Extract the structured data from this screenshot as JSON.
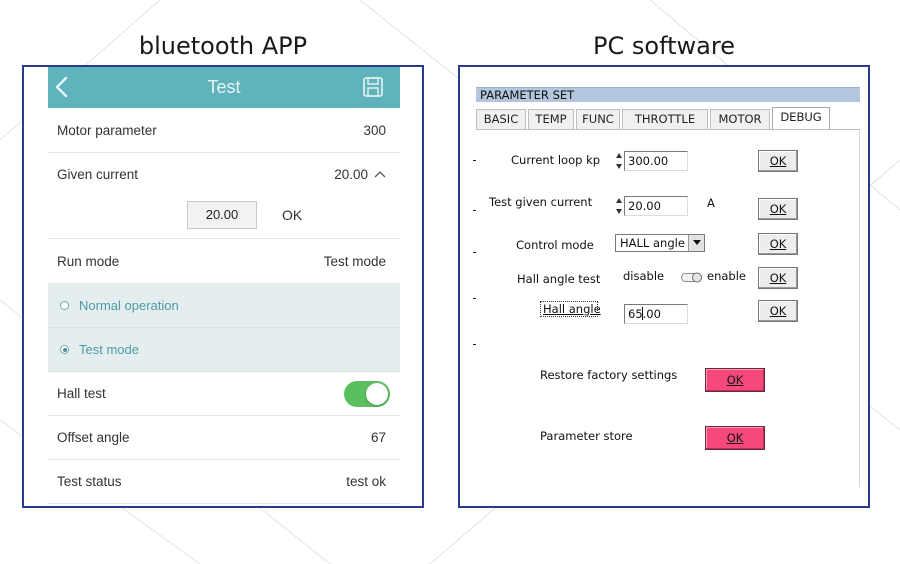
{
  "captions": {
    "left": "bluetooth APP",
    "right": "PC software"
  },
  "app": {
    "title": "Test",
    "motor_parameter": {
      "label": "Motor parameter",
      "value": "300"
    },
    "given_current": {
      "label": "Given current",
      "value": "20.00",
      "input_value": "20.00",
      "ok_label": "OK"
    },
    "run_mode": {
      "label": "Run mode",
      "value": "Test mode",
      "options": [
        {
          "label": "Normal operation",
          "selected": false
        },
        {
          "label": "Test mode",
          "selected": true
        }
      ]
    },
    "hall_test": {
      "label": "Hall test",
      "enabled": true
    },
    "offset_angle": {
      "label": "Offset angle",
      "value": "67"
    },
    "test_status": {
      "label": "Test status",
      "value": "test ok"
    },
    "colors": {
      "header": "#5fb3bd",
      "toggle_on": "#5bbf5f",
      "option_bg": "#e5eeef",
      "option_text": "#4e9aa3"
    }
  },
  "pc": {
    "title": "PARAMETER SET",
    "tabs": [
      {
        "label": "BASIC",
        "active": false
      },
      {
        "label": "TEMP",
        "active": false
      },
      {
        "label": "FUNC",
        "active": false
      },
      {
        "label": "THROTTLE",
        "active": false
      },
      {
        "label": "MOTOR",
        "active": false
      },
      {
        "label": "DEBUG",
        "active": true
      }
    ],
    "current_loop_kp": {
      "label": "Current loop kp",
      "value": "300.00",
      "ok_label": "OK"
    },
    "test_given_current": {
      "label": "Test given current",
      "value": "20.00",
      "unit": "A",
      "ok_label": "OK"
    },
    "control_mode": {
      "label": "Control mode",
      "value": "HALL angle",
      "ok_label": "OK"
    },
    "hall_angle_test": {
      "label": "Hall angle test",
      "off_label": "disable",
      "on_label": "enable",
      "ok_label": "OK"
    },
    "hall_angle": {
      "label": "Hall angle",
      "value": "65.00",
      "ok_label": "OK"
    },
    "restore": {
      "label": "Restore factory settings",
      "ok_label": "OK"
    },
    "store": {
      "label": "Parameter store",
      "ok_label": "OK"
    },
    "colors": {
      "title_bar": "#b4c6dd",
      "action_button": "#f4497a"
    }
  }
}
